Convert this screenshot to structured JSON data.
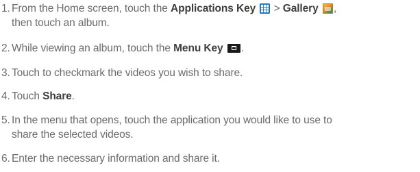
{
  "steps": [
    {
      "number": "1.",
      "parts": {
        "a": "From the Home screen, touch the ",
        "b": "Applications Key",
        "c": " > ",
        "d": "Gallery",
        "e": ",",
        "line2": "then touch an album."
      },
      "icons": [
        "applications-key-icon",
        "gallery-icon"
      ]
    },
    {
      "number": "2.",
      "parts": {
        "a": "While viewing an album, touch the ",
        "b": "Menu Key",
        "c": "."
      },
      "icons": [
        "menu-key-icon"
      ]
    },
    {
      "number": "3.",
      "text": "Touch to checkmark the videos you wish to share."
    },
    {
      "number": "4.",
      "parts": {
        "a": "Touch ",
        "b": "Share",
        "c": "."
      }
    },
    {
      "number": "5.",
      "parts": {
        "a": "In the menu that opens, touch the application you would like to use to",
        "line2": "share the selected videos."
      }
    },
    {
      "number": "6.",
      "text": "Enter the necessary information and share it."
    }
  ],
  "colors": {
    "body_text": "#6a6a6a",
    "bold_text": "#3e3e3e",
    "applications_icon": "#2a86c8",
    "menu_icon": "#1a1a1a"
  }
}
